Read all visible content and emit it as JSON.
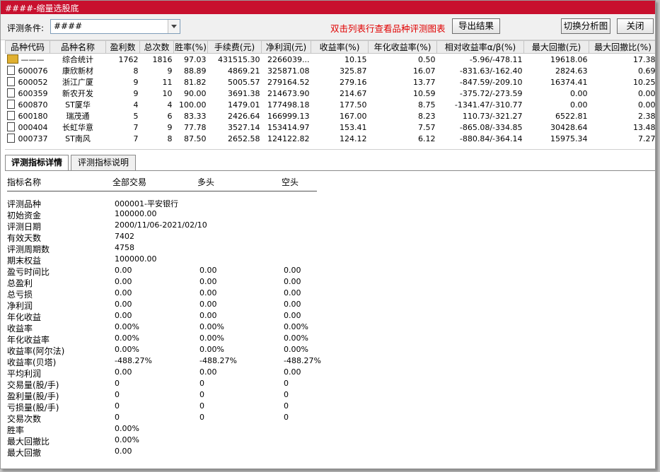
{
  "window": {
    "title": "####-缩量选股底"
  },
  "toolbar": {
    "condition_label": "评测条件:",
    "condition_value": "####",
    "hint": "双击列表行查看品种评测图表",
    "export_label": "导出结果",
    "switch_label": "切换分析图",
    "close_label": "关闭"
  },
  "grid": {
    "columns": [
      "品种代码",
      "品种名称",
      "盈利数",
      "总次数",
      "胜率(%)",
      "手续费(元)",
      "净利润(元)",
      "收益率(%)",
      "年化收益率(%)",
      "相对收益率α/β(%)",
      "最大回撤(元)",
      "最大回撤比(%)"
    ],
    "rows": [
      [
        "———",
        "综合统计",
        "1762",
        "1816",
        "97.03",
        "431515.30",
        "2266039...",
        "10.15",
        "0.50",
        "-5.96/-478.11",
        "19618.06",
        "17.38"
      ],
      [
        "600076",
        "康欣新材",
        "8",
        "9",
        "88.89",
        "4869.21",
        "325871.08",
        "325.87",
        "16.07",
        "-831.63/-162.40",
        "2824.63",
        "0.69"
      ],
      [
        "600052",
        "浙江广厦",
        "9",
        "11",
        "81.82",
        "5005.57",
        "279164.52",
        "279.16",
        "13.77",
        "-847.59/-209.10",
        "16374.41",
        "10.25"
      ],
      [
        "600359",
        "新农开发",
        "9",
        "10",
        "90.00",
        "3691.38",
        "214673.90",
        "214.67",
        "10.59",
        "-375.72/-273.59",
        "0.00",
        "0.00"
      ],
      [
        "600870",
        "ST厦华",
        "4",
        "4",
        "100.00",
        "1479.01",
        "177498.18",
        "177.50",
        "8.75",
        "-1341.47/-310.77",
        "0.00",
        "0.00"
      ],
      [
        "600180",
        "瑞茂通",
        "5",
        "6",
        "83.33",
        "2426.64",
        "166999.13",
        "167.00",
        "8.23",
        "110.73/-321.27",
        "6522.81",
        "2.38"
      ],
      [
        "000404",
        "长虹华意",
        "7",
        "9",
        "77.78",
        "3527.14",
        "153414.97",
        "153.41",
        "7.57",
        "-865.08/-334.85",
        "30428.64",
        "13.48"
      ],
      [
        "000737",
        "ST南风",
        "7",
        "8",
        "87.50",
        "2652.58",
        "124122.82",
        "124.12",
        "6.12",
        "-880.84/-364.14",
        "15975.34",
        "7.27"
      ]
    ]
  },
  "tabs": [
    "评测指标详情",
    "评测指标说明"
  ],
  "detail": {
    "headers": [
      "指标名称",
      "全部交易",
      "多头",
      "空头"
    ],
    "rows": [
      [
        "评测品种",
        "000001-平安银行",
        "",
        ""
      ],
      [
        "初始资金",
        "100000.00",
        "",
        ""
      ],
      [
        "评测日期",
        "2000/11/06-2021/02/10",
        "",
        ""
      ],
      [
        "有效天数",
        "7402",
        "",
        ""
      ],
      [
        "评测周期数",
        "4758",
        "",
        ""
      ],
      [
        "期末权益",
        "100000.00",
        "",
        ""
      ],
      [
        "盈亏时间比",
        "0.00",
        "0.00",
        "0.00"
      ],
      [
        "总盈利",
        "0.00",
        "0.00",
        "0.00"
      ],
      [
        "总亏损",
        "0.00",
        "0.00",
        "0.00"
      ],
      [
        "净利润",
        "0.00",
        "0.00",
        "0.00"
      ],
      [
        "年化收益",
        "0.00",
        "0.00",
        "0.00"
      ],
      [
        "收益率",
        "0.00%",
        "0.00%",
        "0.00%"
      ],
      [
        "年化收益率",
        "0.00%",
        "0.00%",
        "0.00%"
      ],
      [
        "收益率(阿尔法)",
        "0.00%",
        "0.00%",
        "0.00%"
      ],
      [
        "收益率(贝塔)",
        "-488.27%",
        "-488.27%",
        "-488.27%"
      ],
      [
        "平均利润",
        "0.00",
        "0.00",
        "0.00"
      ],
      [
        "交易量(股/手)",
        "0",
        "0",
        "0"
      ],
      [
        "盈利量(股/手)",
        "0",
        "0",
        "0"
      ],
      [
        "亏损量(股/手)",
        "0",
        "0",
        "0"
      ],
      [
        "交易次数",
        "0",
        "0",
        "0"
      ],
      [
        "胜率",
        "0.00%",
        "",
        ""
      ],
      [
        "最大回撤比",
        "0.00%",
        "",
        ""
      ],
      [
        "最大回撤",
        "0.00",
        "",
        ""
      ]
    ]
  }
}
